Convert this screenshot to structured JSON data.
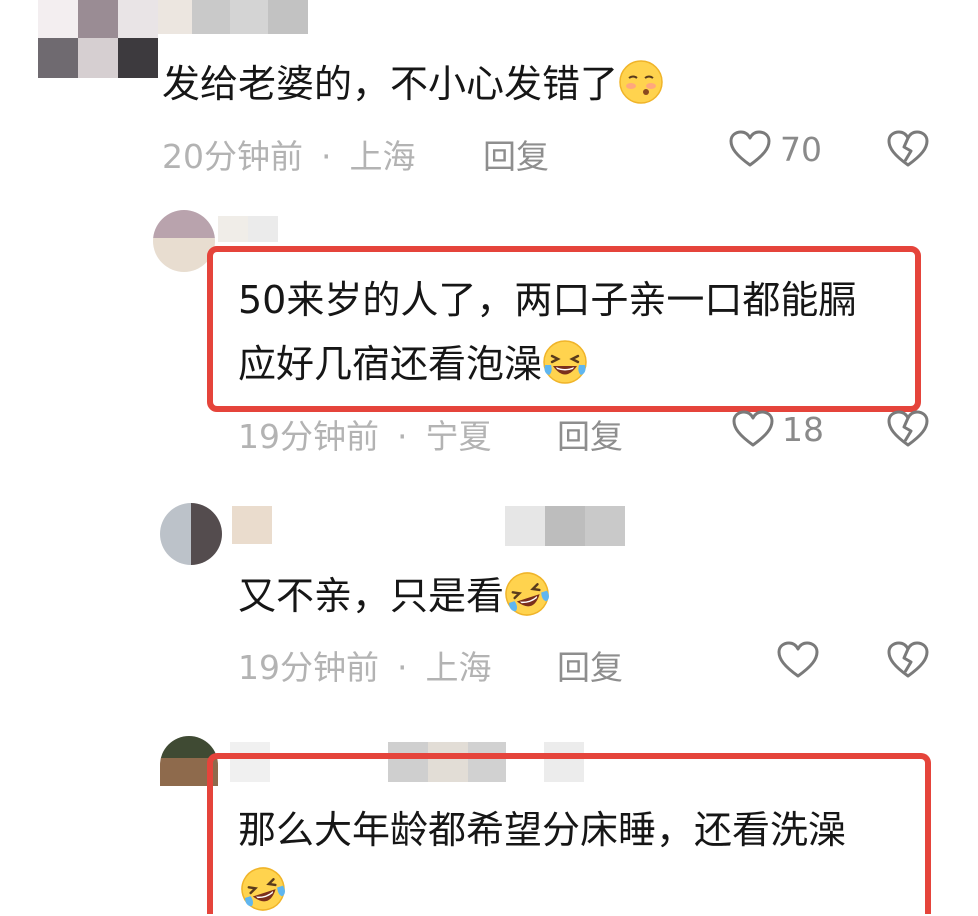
{
  "comments": [
    {
      "text": "发给老婆的，不小心发错了",
      "time": "20分钟前",
      "location": "上海",
      "reply_label": "回复",
      "likes": "70"
    },
    {
      "text_line1": "50来岁的人了，两口子亲一口都能膈",
      "text_line2": "应好几宿还看泡澡",
      "time": "19分钟前",
      "location": "宁夏",
      "reply_label": "回复",
      "likes": "18"
    },
    {
      "text": "又不亲，只是看",
      "time": "19分钟前",
      "location": "上海",
      "reply_label": "回复"
    },
    {
      "text": "那么大年龄都希望分床睡，还看洗澡"
    }
  ],
  "separator": "·",
  "icons": {
    "like": "heart-outline-icon",
    "dislike": "broken-heart-icon",
    "emoji_shy": "flushed-emoji-icon",
    "emoji_laugh": "laughing-crying-emoji-icon"
  },
  "colors": {
    "highlight": "#e5443b",
    "meta": "#b3b3b3",
    "text": "#161616"
  }
}
